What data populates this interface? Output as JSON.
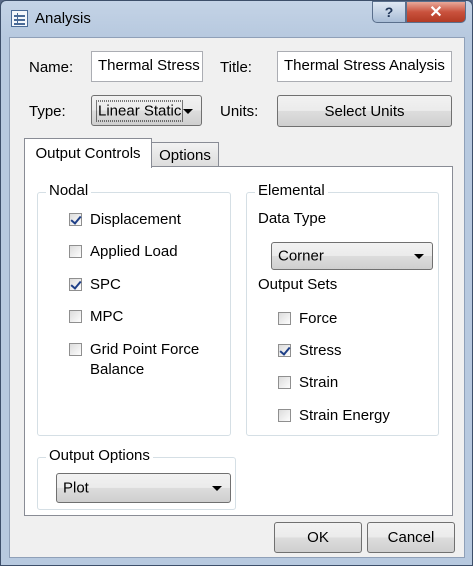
{
  "window": {
    "title": "Analysis",
    "help_glyph": "?",
    "close_glyph": "✕"
  },
  "form": {
    "name_label": "Name:",
    "name_value": "Thermal Stress",
    "title_label": "Title:",
    "title_value": "Thermal Stress Analysis",
    "type_label": "Type:",
    "type_value": "Linear Static",
    "units_label": "Units:",
    "units_button": "Select Units"
  },
  "tabs": [
    {
      "label": "Output Controls",
      "active": true
    },
    {
      "label": "Options",
      "active": false
    }
  ],
  "nodal": {
    "title": "Nodal",
    "items": [
      {
        "label": "Displacement",
        "checked": true
      },
      {
        "label": "Applied Load",
        "checked": false
      },
      {
        "label": "SPC",
        "checked": true
      },
      {
        "label": "MPC",
        "checked": false
      },
      {
        "label": "Grid Point Force",
        "label2": "Balance",
        "checked": false
      }
    ]
  },
  "elemental": {
    "title": "Elemental",
    "data_type_label": "Data Type",
    "data_type_value": "Corner",
    "output_sets_label": "Output Sets",
    "items": [
      {
        "label": "Force",
        "checked": false
      },
      {
        "label": "Stress",
        "checked": true
      },
      {
        "label": "Strain",
        "checked": false
      },
      {
        "label": "Strain Energy",
        "checked": false
      }
    ]
  },
  "output_options": {
    "title": "Output Options",
    "value": "Plot"
  },
  "footer": {
    "ok": "OK",
    "cancel": "Cancel"
  }
}
